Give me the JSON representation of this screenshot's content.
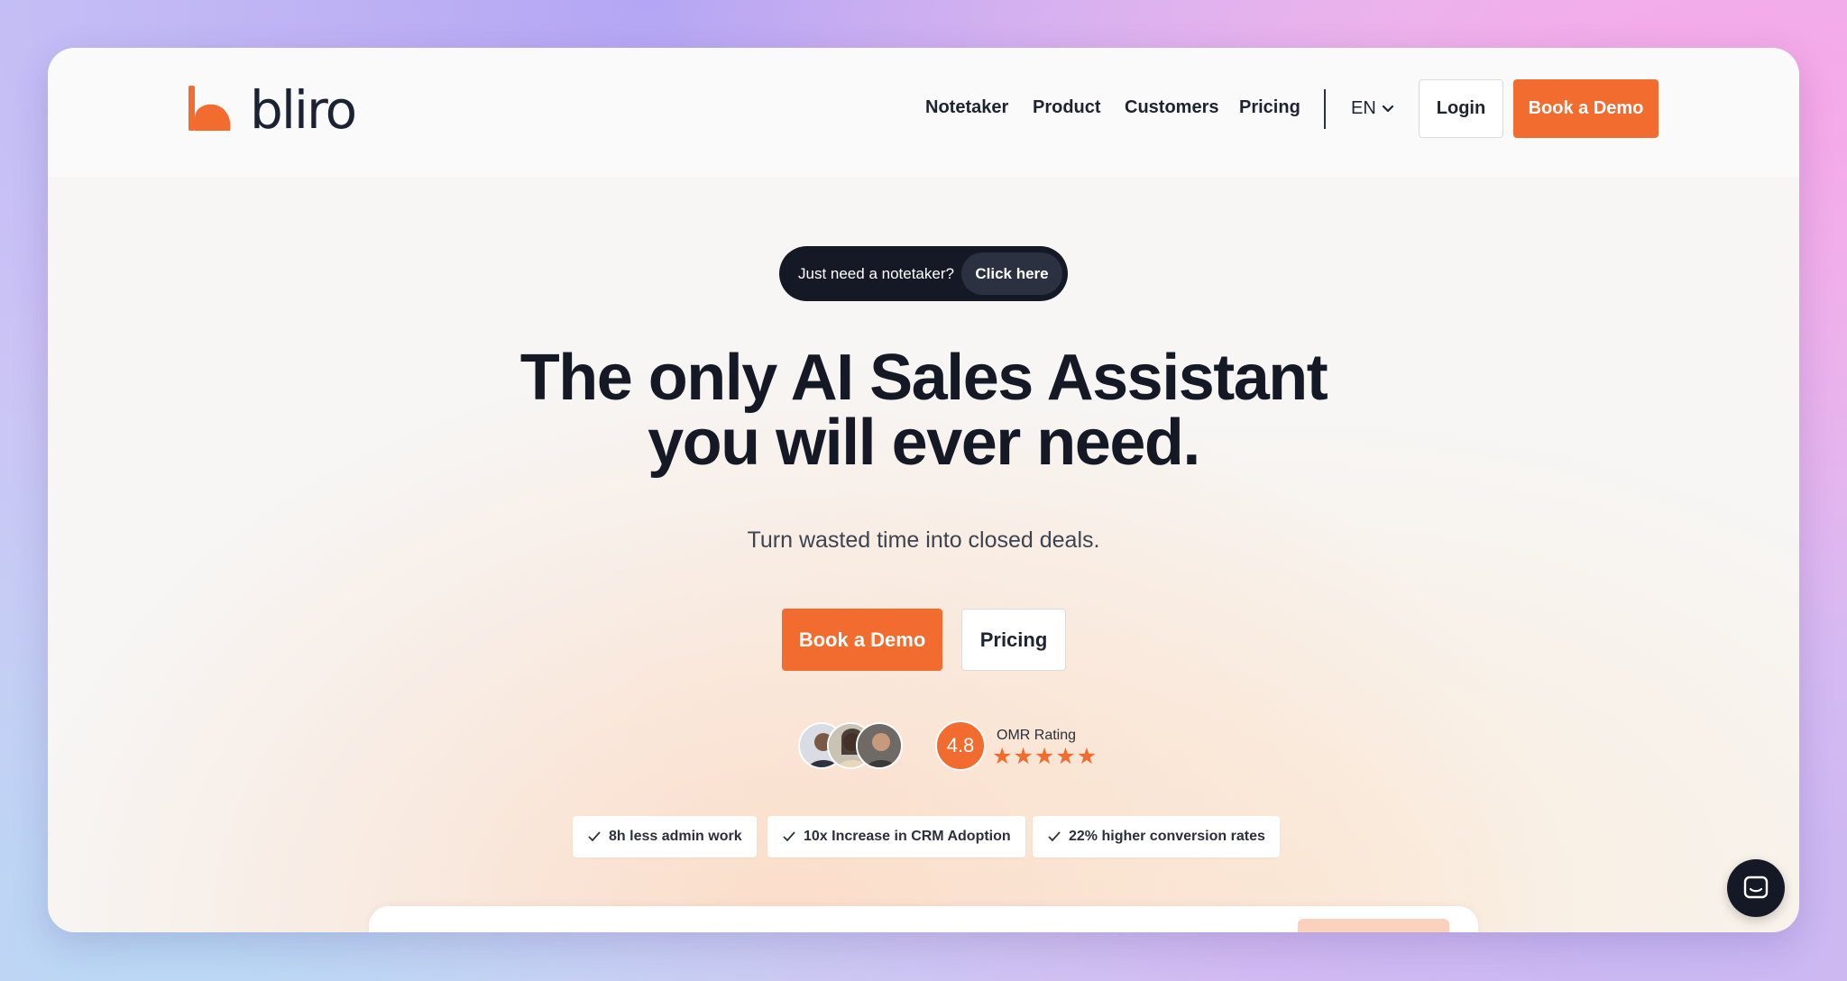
{
  "brand": {
    "name": "bliro",
    "accent": "#f26b2f",
    "dark": "#141925"
  },
  "nav": {
    "links": [
      "Notetaker",
      "Product",
      "Customers",
      "Pricing"
    ],
    "language": "EN",
    "login_label": "Login",
    "demo_label": "Book a Demo"
  },
  "hero": {
    "pill_text": "Just need a notetaker?",
    "pill_button": "Click here",
    "headline_line1": "The only AI Sales Assistant",
    "headline_line2": "you will ever need.",
    "subheadline": "Turn wasted time into closed deals.",
    "primary_button": "Book a Demo",
    "secondary_button": "Pricing"
  },
  "rating": {
    "score": "4.8",
    "label": "OMR Rating",
    "stars": 5
  },
  "features": [
    "8h less admin work",
    "10x Increase in CRM Adoption",
    "22% higher conversion rates"
  ],
  "icons": {
    "logo": "bliro-logo-mark",
    "language_dropdown": "chevron-down-icon",
    "feature_check": "check-icon",
    "chat_widget": "chat-icon"
  }
}
